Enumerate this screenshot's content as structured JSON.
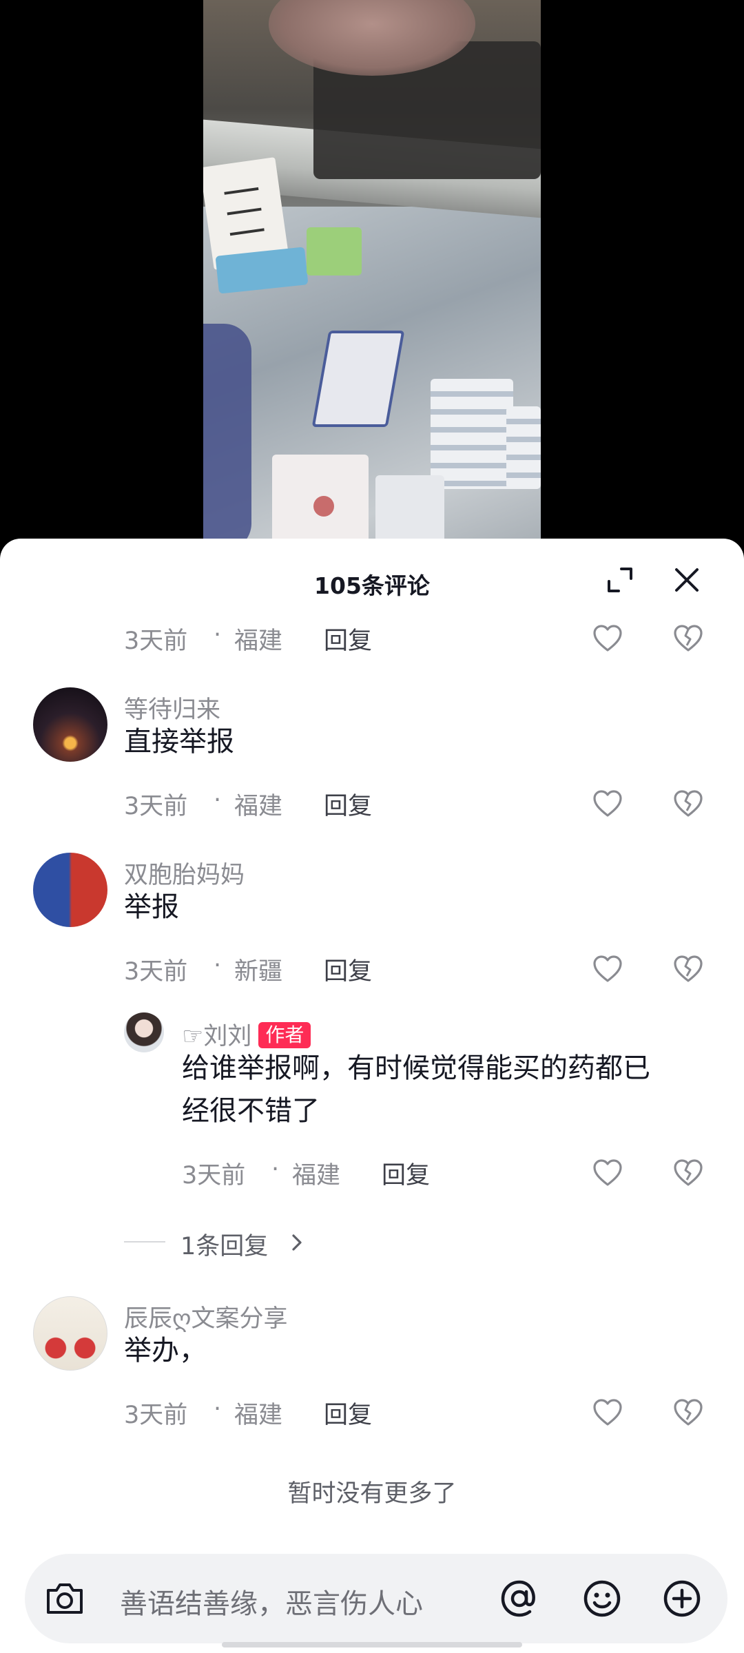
{
  "sheet": {
    "title": "105条评论"
  },
  "comments": [
    {
      "time": "3天前",
      "dot": "·",
      "location": "福建",
      "reply_label": "回复"
    },
    {
      "username": "等待归来",
      "content": "直接举报",
      "time": "3天前",
      "dot": "·",
      "location": "福建",
      "reply_label": "回复"
    },
    {
      "username": "双胞胎妈妈",
      "content": "举报",
      "time": "3天前",
      "dot": "·",
      "location": "新疆",
      "reply_label": "回复"
    },
    {
      "username": "☞刘刘",
      "badge": "作者",
      "content_line1": "给谁举报啊，有时候觉得能买的药都已",
      "content_line2": "经很不错了",
      "time": "3天前",
      "dot": "·",
      "location": "福建",
      "reply_label": "回复"
    },
    {
      "username": "辰辰ღ文案分享",
      "content": "举办，",
      "time": "3天前",
      "dot": "·",
      "location": "福建",
      "reply_label": "回复"
    }
  ],
  "more_replies": "1条回复",
  "no_more": "暂时没有更多了",
  "input": {
    "placeholder": "善语结善缘，恶言伤人心"
  },
  "icons": {
    "expand": "expand-icon",
    "close": "close-icon",
    "like": "heart-outline-icon",
    "dislike": "broken-heart-icon",
    "camera": "camera-icon",
    "mention": "at-sign-icon",
    "emoji": "smiley-icon",
    "add": "plus-circle-icon"
  },
  "colors": {
    "badge": "#fe2c55",
    "secondary_text": "#8a8b91",
    "primary_text": "#161823"
  }
}
